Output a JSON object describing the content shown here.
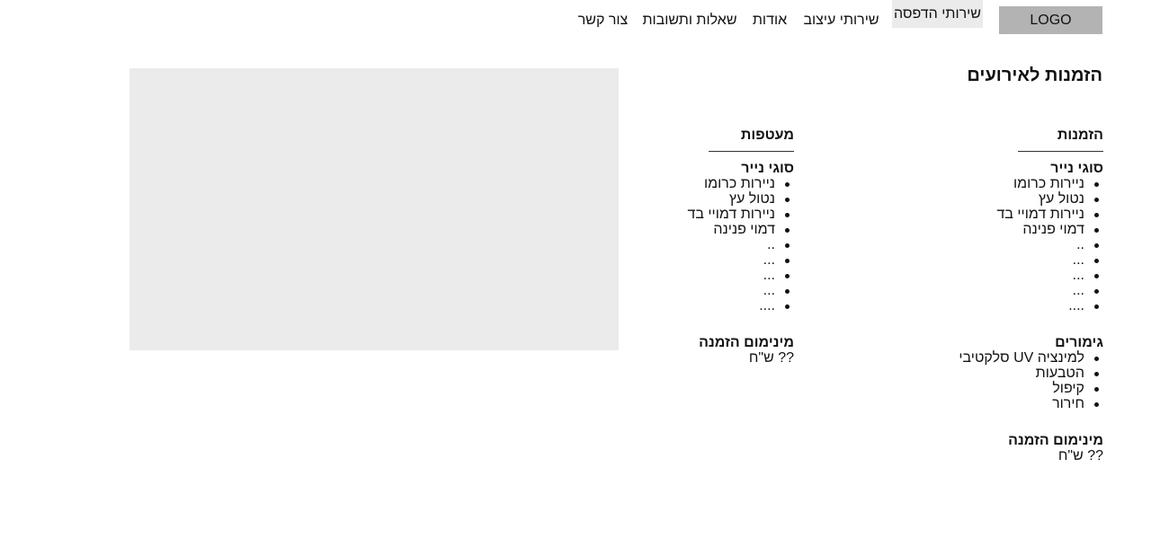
{
  "header": {
    "logo": "LOGO",
    "nav": [
      {
        "label": "שירותי הדפסה",
        "active": true
      },
      {
        "label": "שירותי עיצוב",
        "active": false
      },
      {
        "label": "אודות",
        "active": false
      },
      {
        "label": "שאלות ותשובות",
        "active": false
      },
      {
        "label": "צור קשר",
        "active": false
      }
    ]
  },
  "page": {
    "title": "הזמנות לאירועים"
  },
  "invitations": {
    "heading": "הזמנות",
    "paper_heading": "סוגי נייר",
    "paper_items": [
      "ניירות כרומו",
      "נטול עץ",
      "ניירות דמויי בד",
      "דמוי פנינה",
      "..",
      "...",
      "...",
      "...",
      "...."
    ],
    "finishes_heading": "גימורים",
    "finishes_items": [
      "למינציה UV סלקטיבי",
      "הטבעות",
      "קיפול",
      "חירור"
    ],
    "minimum_heading": "מינימום הזמנה",
    "minimum_value": "?? ש\"ח"
  },
  "envelopes": {
    "heading": "מעטפות",
    "paper_heading": "סוגי נייר",
    "paper_items": [
      "ניירות כרומו",
      "נטול עץ",
      "ניירות דמויי בד",
      "דמוי פנינה",
      "..",
      "...",
      "...",
      "...",
      "...."
    ],
    "minimum_heading": "מינימום הזמנה",
    "minimum_value": "?? ש\"ח"
  }
}
